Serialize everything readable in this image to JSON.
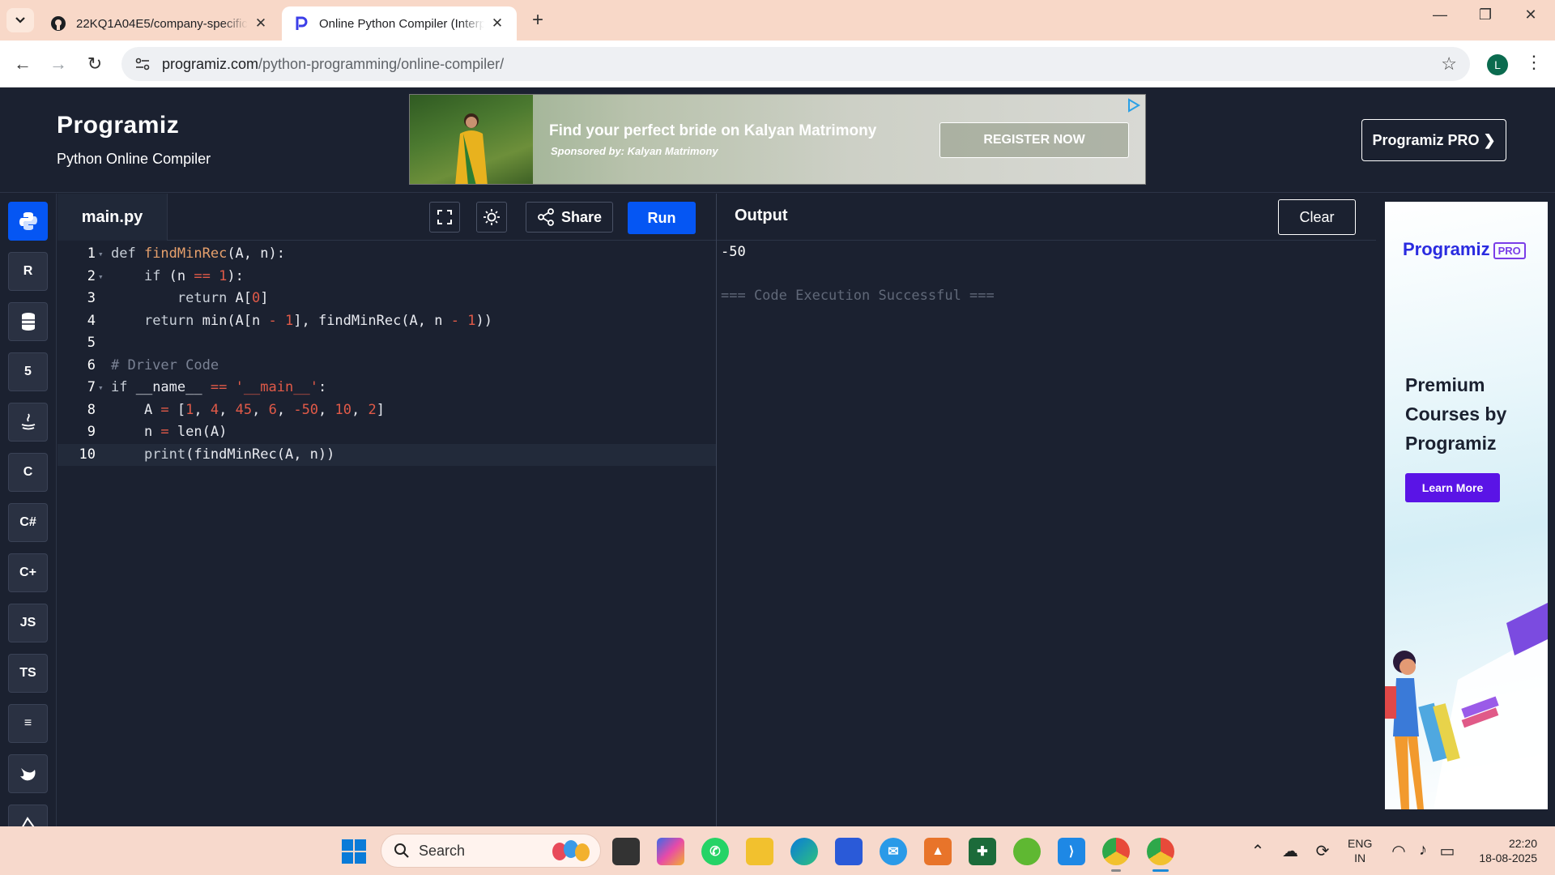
{
  "browser": {
    "tabs": [
      {
        "title": "22KQ1A04E5/company-specific",
        "active": false
      },
      {
        "title": "Online Python Compiler (Interpreter)",
        "active": true
      }
    ],
    "url_host": "programiz.com",
    "url_path": "/python-programming/online-compiler/",
    "profile_initial": "L"
  },
  "site": {
    "logo_text": "Programiz",
    "subtitle": "Python Online Compiler",
    "pro_button_label": "Programiz PRO ❯"
  },
  "ad": {
    "title": "Find your perfect bride on Kalyan Matrimony",
    "sponsor": "Sponsored by: Kalyan Matrimony",
    "cta": "REGISTER NOW"
  },
  "sidebar": {
    "languages": [
      {
        "name": "python-icon",
        "label": "",
        "active": true
      },
      {
        "name": "r-icon",
        "label": "R",
        "active": false
      },
      {
        "name": "sql-icon",
        "label": "",
        "active": false
      },
      {
        "name": "html-icon",
        "label": "5",
        "active": false
      },
      {
        "name": "java-icon",
        "label": "",
        "active": false
      },
      {
        "name": "c-icon",
        "label": "C",
        "active": false
      },
      {
        "name": "csharp-icon",
        "label": "C#",
        "active": false
      },
      {
        "name": "cpp-icon",
        "label": "C+",
        "active": false
      },
      {
        "name": "js-icon",
        "label": "JS",
        "active": false
      },
      {
        "name": "ts-icon",
        "label": "TS",
        "active": false
      },
      {
        "name": "go-icon",
        "label": "≡",
        "active": false
      },
      {
        "name": "swift-icon",
        "label": "",
        "active": false
      },
      {
        "name": "rust-icon",
        "label": "",
        "active": false
      }
    ]
  },
  "editor": {
    "filename": "main.py",
    "share_label": "Share",
    "run_label": "Run",
    "lines": [
      {
        "n": "1",
        "fold": true,
        "tokens": [
          [
            "kw",
            "def "
          ],
          [
            "fn",
            "findMinRec"
          ],
          [
            "plain",
            "(A, n):"
          ]
        ]
      },
      {
        "n": "2",
        "fold": true,
        "tokens": [
          [
            "plain",
            "    "
          ],
          [
            "kw",
            "if "
          ],
          [
            "plain",
            "(n "
          ],
          [
            "op",
            "=="
          ],
          [
            "plain",
            " "
          ],
          [
            "num",
            "1"
          ],
          [
            "plain",
            "):"
          ]
        ]
      },
      {
        "n": "3",
        "fold": false,
        "tokens": [
          [
            "plain",
            "        "
          ],
          [
            "kw",
            "return "
          ],
          [
            "plain",
            "A["
          ],
          [
            "num",
            "0"
          ],
          [
            "plain",
            "]"
          ]
        ]
      },
      {
        "n": "4",
        "fold": false,
        "tokens": [
          [
            "plain",
            "    "
          ],
          [
            "kw",
            "return "
          ],
          [
            "plain",
            "min(A[n "
          ],
          [
            "op",
            "-"
          ],
          [
            "plain",
            " "
          ],
          [
            "num",
            "1"
          ],
          [
            "plain",
            "], findMinRec(A, n "
          ],
          [
            "op",
            "-"
          ],
          [
            "plain",
            " "
          ],
          [
            "num",
            "1"
          ],
          [
            "plain",
            "))"
          ]
        ]
      },
      {
        "n": "5",
        "fold": false,
        "tokens": []
      },
      {
        "n": "6",
        "fold": false,
        "tokens": [
          [
            "com",
            "# Driver Code"
          ]
        ]
      },
      {
        "n": "7",
        "fold": true,
        "tokens": [
          [
            "kw",
            "if "
          ],
          [
            "plain",
            "__name__ "
          ],
          [
            "op",
            "=="
          ],
          [
            "plain",
            " "
          ],
          [
            "str",
            "'__main__'"
          ],
          [
            "plain",
            ":"
          ]
        ]
      },
      {
        "n": "8",
        "fold": false,
        "tokens": [
          [
            "plain",
            "    A "
          ],
          [
            "op",
            "="
          ],
          [
            "plain",
            " ["
          ],
          [
            "num",
            "1"
          ],
          [
            "plain",
            ", "
          ],
          [
            "num",
            "4"
          ],
          [
            "plain",
            ", "
          ],
          [
            "num",
            "45"
          ],
          [
            "plain",
            ", "
          ],
          [
            "num",
            "6"
          ],
          [
            "plain",
            ", "
          ],
          [
            "num",
            "-50"
          ],
          [
            "plain",
            ", "
          ],
          [
            "num",
            "10"
          ],
          [
            "plain",
            ", "
          ],
          [
            "num",
            "2"
          ],
          [
            "plain",
            "]"
          ]
        ]
      },
      {
        "n": "9",
        "fold": false,
        "tokens": [
          [
            "plain",
            "    n "
          ],
          [
            "op",
            "="
          ],
          [
            "plain",
            " len(A)"
          ]
        ]
      },
      {
        "n": "10",
        "fold": false,
        "current": true,
        "tokens": [
          [
            "plain",
            "    "
          ],
          [
            "kw",
            "print"
          ],
          [
            "plain",
            "(findMinRec(A, n))"
          ]
        ]
      }
    ]
  },
  "output": {
    "title": "Output",
    "clear_label": "Clear",
    "result": "-50",
    "status": "=== Code Execution Successful ==="
  },
  "side_ad": {
    "logo": "Programiz",
    "tag": "PRO",
    "headline": [
      "Premium",
      "Courses by",
      "Programiz"
    ],
    "button": "Learn More"
  },
  "taskbar": {
    "search_label": "Search",
    "lang_1": "ENG",
    "lang_2": "IN",
    "time": "22:20",
    "date": "18-08-2025"
  },
  "colors": {
    "bg": "#1b2130",
    "accent": "#0556f3",
    "keyword": "#c8cfd8",
    "function": "#e6a06c",
    "number": "#e15a48",
    "comment": "#7a8294"
  }
}
